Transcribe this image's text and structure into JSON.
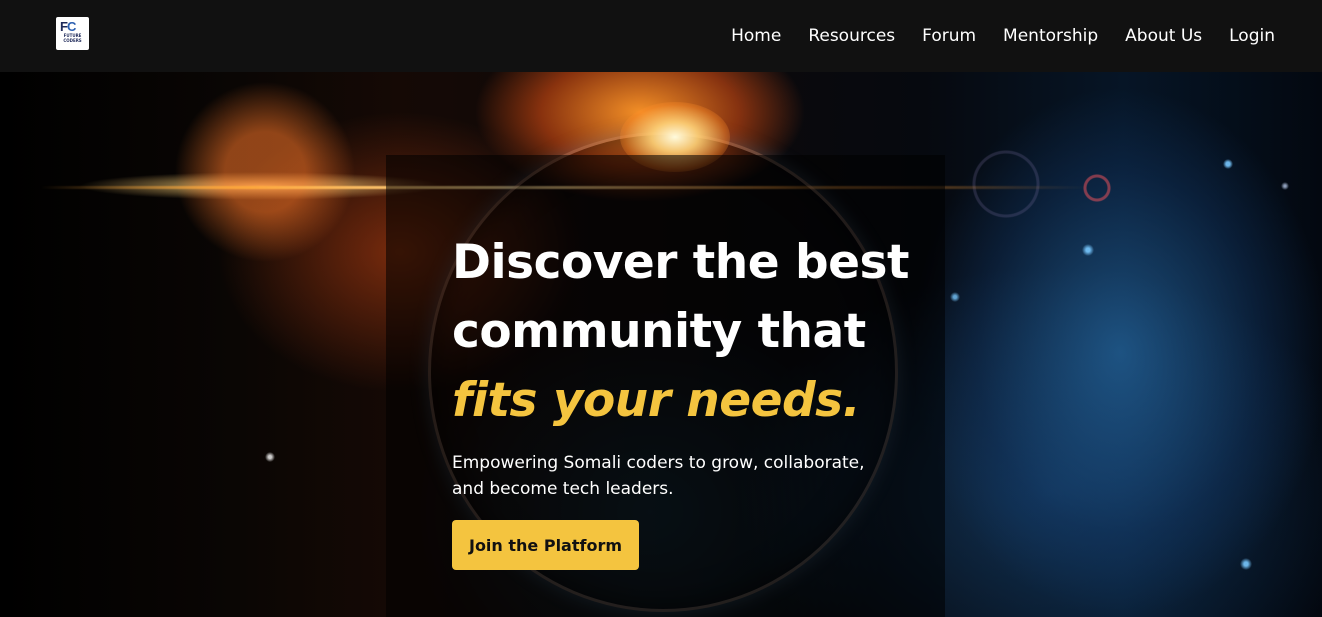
{
  "logo": {
    "mark_f": "F",
    "mark_c": "C",
    "subtitle": "FUTURE CODERS"
  },
  "nav": {
    "items": [
      {
        "label": "Home"
      },
      {
        "label": "Resources"
      },
      {
        "label": "Forum"
      },
      {
        "label": "Mentorship"
      },
      {
        "label": "About Us"
      },
      {
        "label": "Login"
      }
    ]
  },
  "hero": {
    "headline_line1": "Discover the best",
    "headline_line2": "community that",
    "headline_accent": "fits your needs.",
    "subtext": "Empowering Somali coders to grow, collaborate, and become tech leaders.",
    "cta_label": "Join the Platform"
  },
  "colors": {
    "accent": "#f4c43f",
    "navbar": "#111111",
    "text": "#ffffff"
  }
}
